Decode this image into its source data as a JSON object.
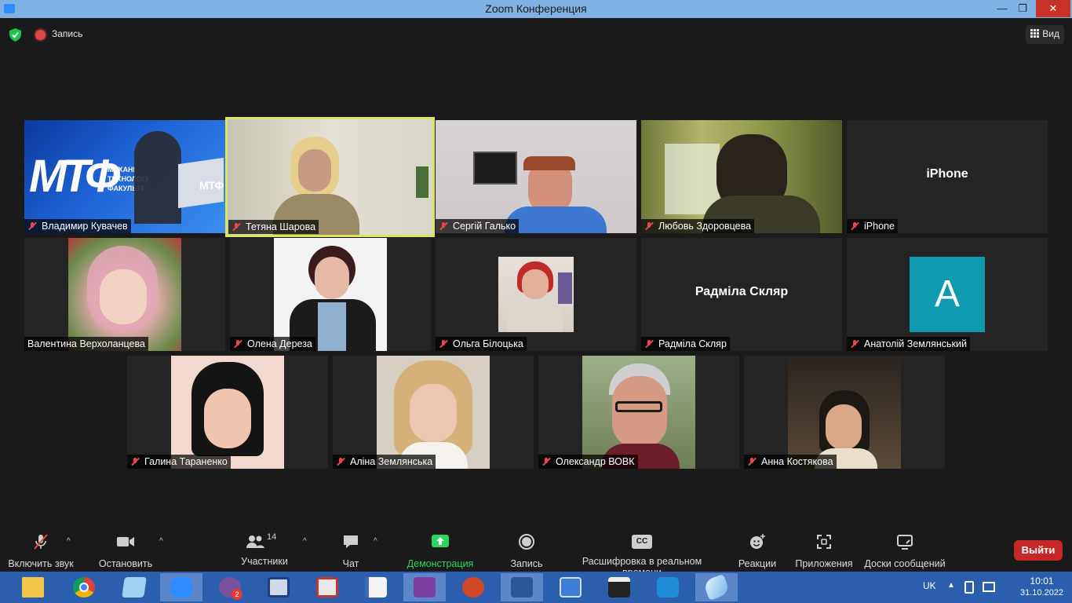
{
  "window": {
    "title": "Zoom Конференция",
    "minimize": "—",
    "maximize": "❐",
    "close": "✕"
  },
  "topbar": {
    "recording_label": "Запись",
    "view_label": "Вид"
  },
  "participants": [
    {
      "name": "Владимир Кувачев",
      "muted": true,
      "banner": {
        "line1": "МЕХАНІ",
        "line2": "ТЕХНОЛОГІ",
        "line3": "ФАКУЛЬТЕ",
        "logo": "МТФ",
        "logo_small": "МТФ"
      }
    },
    {
      "name": "Тетяна Шарова",
      "muted": true,
      "active_speaker": true
    },
    {
      "name": "Сергій Галько",
      "muted": true
    },
    {
      "name": "Любовь Здоровцева",
      "muted": true
    },
    {
      "name": "iPhone",
      "muted": true,
      "display_name": "iPhone"
    },
    {
      "name": "Валентина Верхоланцева",
      "muted": false
    },
    {
      "name": "Олена Дереза",
      "muted": true
    },
    {
      "name": "Ольга Білоцька",
      "muted": true
    },
    {
      "name": "Радміла Скляр",
      "muted": true,
      "display_name": "Радміла Скляр"
    },
    {
      "name": "Анатолій Землянський",
      "muted": true,
      "avatar_letter": "A",
      "avatar_color": "#0f9ab1"
    },
    {
      "name": "Галина Тараненко",
      "muted": true
    },
    {
      "name": "Аліна Землянська",
      "muted": true
    },
    {
      "name": "Олександр ВОВК",
      "muted": true
    },
    {
      "name": "Анна Костякова",
      "muted": true
    }
  ],
  "toolbar": {
    "audio": "Включить звук",
    "video": "Остановить видео",
    "participants": "Участники",
    "participants_count": "14",
    "chat": "Чат",
    "share": "Демонстрация экрана",
    "record": "Запись",
    "captions": "Расшифровка в реальном времени",
    "captions_icon": "CC",
    "reactions": "Реакции",
    "apps": "Приложения",
    "whiteboards": "Доски сообщений",
    "leave": "Выйти"
  },
  "taskbar": {
    "apps": [
      "file-explorer",
      "chrome",
      "notepad",
      "zoom",
      "viber",
      "lenovo",
      "pdf-tool",
      "docs",
      "pdf-editor",
      "powerpoint",
      "word",
      "remote-desktop",
      "media-player-classic",
      "zoom-meetings",
      "feather-app"
    ],
    "viber_badge": "2",
    "lang": "UK",
    "time": "10:01",
    "date": "31.10.2022"
  },
  "colors": {
    "titlebar": "#7fb2e3",
    "taskbar": "#2b5fae",
    "active_outline": "#d9e85a",
    "share_green": "#2bd65f",
    "leave_red": "#c62828",
    "muted_red": "#e84848"
  }
}
